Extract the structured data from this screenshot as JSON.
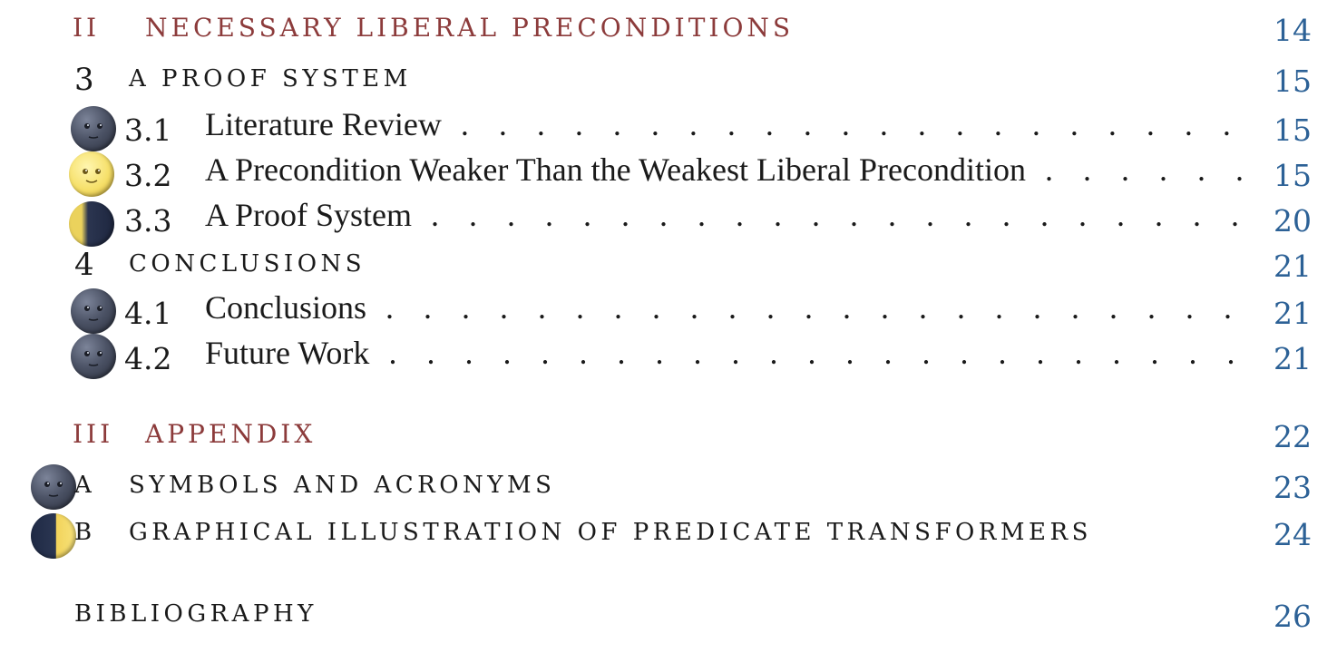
{
  "toc": {
    "part2": {
      "number": "II",
      "title": "NECESSARY LIBERAL PRECONDITIONS",
      "page": "14"
    },
    "chapter3": {
      "number": "3",
      "title": "A PROOF SYSTEM",
      "page": "15"
    },
    "sec3_1": {
      "number": "3.1",
      "title": "Literature Review",
      "page": "15",
      "icon": "new-moon-face-icon"
    },
    "sec3_2": {
      "number": "3.2",
      "title": "A Precondition Weaker Than the Weakest Liberal Precondition",
      "page": "15",
      "icon": "full-moon-face-icon"
    },
    "sec3_3": {
      "number": "3.3",
      "title": "A Proof System",
      "page": "20",
      "icon": "waning-crescent-moon-icon"
    },
    "chapter4": {
      "number": "4",
      "title": "CONCLUSIONS",
      "page": "21"
    },
    "sec4_1": {
      "number": "4.1",
      "title": "Conclusions",
      "page": "21",
      "icon": "new-moon-face-icon"
    },
    "sec4_2": {
      "number": "4.2",
      "title": "Future Work",
      "page": "21",
      "icon": "new-moon-face-icon"
    },
    "part3": {
      "number": "III",
      "title": "APPENDIX",
      "page": "22"
    },
    "appA": {
      "number": "A",
      "title": "SYMBOLS AND ACRONYMS",
      "page": "23",
      "icon": "new-moon-face-icon"
    },
    "appB": {
      "number": "B",
      "title": "GRAPHICAL ILLUSTRATION OF PREDICATE TRANSFORMERS",
      "page": "24",
      "icon": "first-quarter-moon-icon"
    },
    "bibliography": {
      "title": "BIBLIOGRAPHY",
      "page": "26"
    }
  },
  "colors": {
    "part_heading": "#8c3b3b",
    "page_number": "#2c6196",
    "text": "#1a1a1a"
  }
}
